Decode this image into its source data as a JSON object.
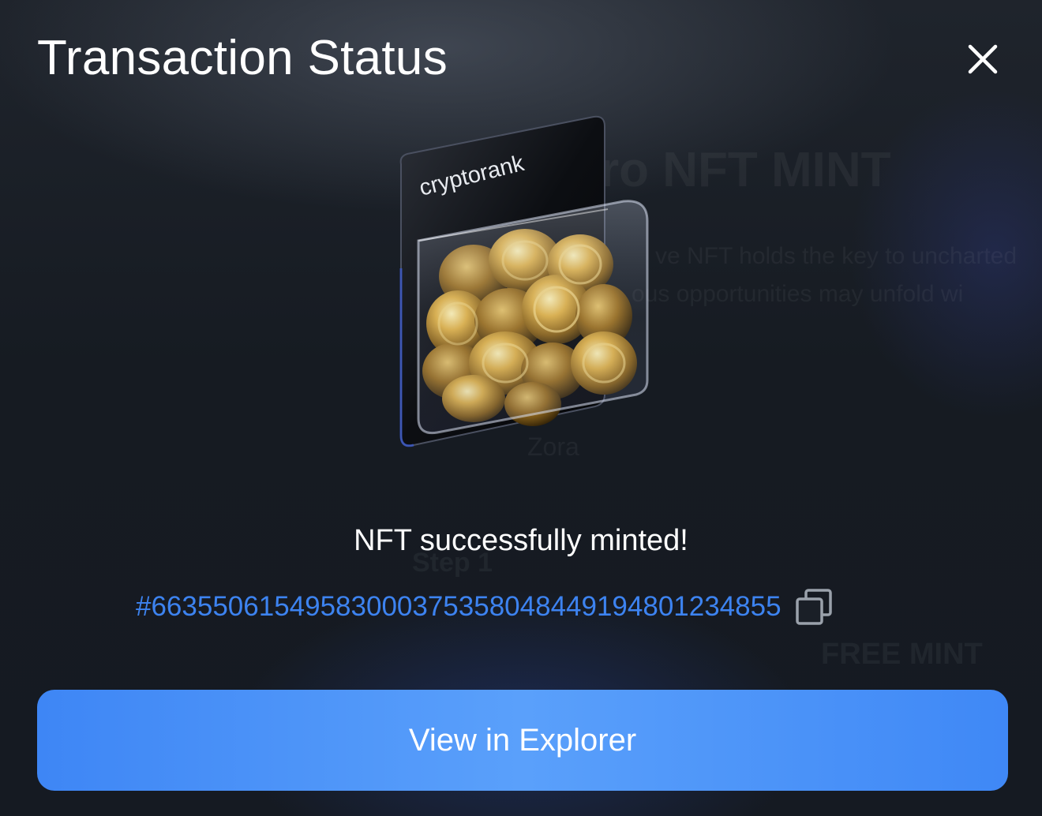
{
  "modal": {
    "title": "Transaction Status",
    "close_icon": "close-icon"
  },
  "illustration": {
    "brand_text": "cryptorank",
    "icon": "coin-jar-illustration"
  },
  "status": {
    "message": "NFT successfully minted!",
    "transaction_hash": "#66355061549583000375358048449194801234855",
    "copy_icon": "copy-icon"
  },
  "action": {
    "explorer_label": "View in Explorer"
  },
  "backdrop": {
    "title": "ro NFT MINT",
    "line1": "ve NFT holds the key to uncharted",
    "line2": "ous opportunities may unfold wi",
    "network": "Zora",
    "step": "Step 1",
    "cta": "FREE MINT"
  },
  "colors": {
    "accent": "#3d83f0",
    "button": "#4a93f8",
    "background": "#161b22"
  }
}
